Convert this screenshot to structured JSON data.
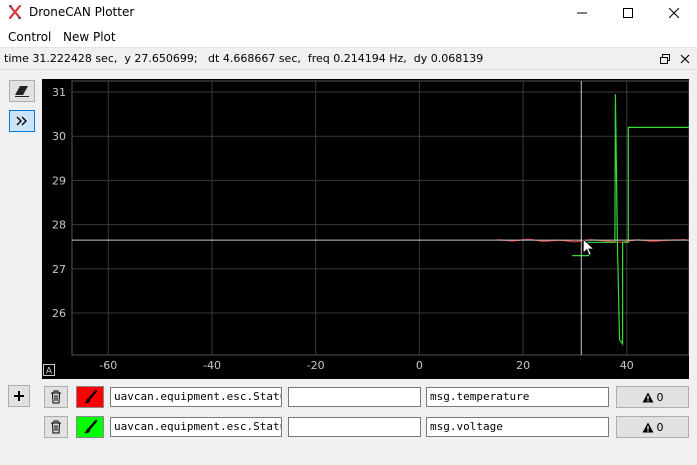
{
  "window": {
    "title": "DroneCAN Plotter"
  },
  "menu": {
    "items": [
      "Control",
      "New Plot"
    ]
  },
  "status": {
    "text": "time 31.222428 sec,  y 27.650699;   dt 4.668667 sec,  freq 0.214194 Hz,  dy 0.068139"
  },
  "plot": {
    "auto_label": "A",
    "colors": {
      "background": "#000000",
      "grid": "#3a3a3a",
      "axis_text": "#c8c8c8",
      "cursor": "#c8c8c8"
    },
    "x_ticks": [
      "-60",
      "-40",
      "-20",
      "0",
      "20",
      "40"
    ],
    "y_ticks": [
      "31",
      "30",
      "29",
      "28",
      "27",
      "26"
    ]
  },
  "chart_data": {
    "type": "line",
    "xlim": [
      -67,
      52
    ],
    "ylim": [
      25.05,
      31.25
    ],
    "grid": true,
    "cursor": {
      "x": 31.222428,
      "y": 27.650699
    },
    "series": [
      {
        "color": "#e03030",
        "x": [
          15,
          18,
          21,
          24,
          27,
          30,
          33,
          36,
          39,
          42,
          45,
          48,
          51.5
        ],
        "y": [
          27.66,
          27.63,
          27.67,
          27.62,
          27.65,
          27.61,
          27.66,
          27.63,
          27.6,
          27.66,
          27.62,
          27.65,
          27.66
        ]
      },
      {
        "color": "#33dd33",
        "x": [
          29.5,
          32.6,
          32.6,
          37.7,
          37.8,
          38.2,
          38.6,
          39.2,
          39.2,
          40.3,
          40.3,
          52
        ],
        "y": [
          27.3,
          27.3,
          27.6,
          27.6,
          30.95,
          27.6,
          25.4,
          25.3,
          27.6,
          27.6,
          30.2,
          30.2
        ]
      }
    ]
  },
  "curves": [
    {
      "color": "#ff0000",
      "message": "uavcan.equipment.esc.Status",
      "extra": "",
      "expression": "msg.temperature",
      "warnings": "0"
    },
    {
      "color": "#00ff00",
      "message": "uavcan.equipment.esc.Status",
      "extra": "",
      "expression": "msg.voltage",
      "warnings": "0"
    }
  ]
}
